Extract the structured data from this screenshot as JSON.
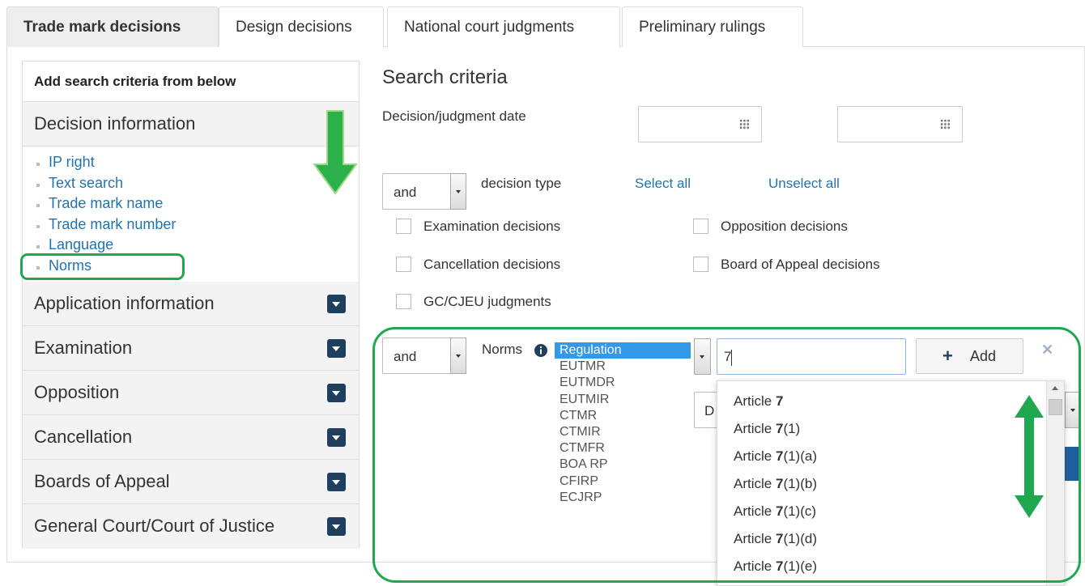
{
  "tabs": [
    "Trade mark decisions",
    "Design decisions",
    "National court judgments",
    "Preliminary rulings"
  ],
  "sidebar": {
    "header": "Add search criteria from below",
    "decision_info_title": "Decision information",
    "decision_info_items": [
      "IP right",
      "Text search",
      "Trade mark name",
      "Trade mark number",
      "Language",
      "Norms"
    ],
    "sections": [
      "Application information",
      "Examination",
      "Opposition",
      "Cancellation",
      "Boards of Appeal",
      "General Court/Court of Justice"
    ]
  },
  "criteria": {
    "title": "Search criteria",
    "date_label": "Decision/judgment date",
    "operator": "and",
    "decision_type_label": "decision type",
    "select_all": "Select all",
    "unselect_all": "Unselect all",
    "checkboxes": [
      "Examination decisions",
      "Opposition decisions",
      "Cancellation decisions",
      "Board of Appeal decisions",
      "GC/CJEU judgments"
    ],
    "norms_operator": "and",
    "norms_label": "Norms",
    "norms_options": [
      "Regulation",
      "EUTMR",
      "EUTMDR",
      "EUTMIR",
      "CTMR",
      "CTMIR",
      "CTMFR",
      "BOA RP",
      "CFIRP",
      "ECJRP"
    ],
    "norms_input_value": "7",
    "add_label": "Add",
    "hidden_select_partial": "D",
    "suggestions": [
      {
        "prefix": "Article ",
        "bold": "7",
        "suffix": ""
      },
      {
        "prefix": "Article ",
        "bold": "7",
        "suffix": "(1)"
      },
      {
        "prefix": "Article ",
        "bold": "7",
        "suffix": "(1)(a)"
      },
      {
        "prefix": "Article ",
        "bold": "7",
        "suffix": "(1)(b)"
      },
      {
        "prefix": "Article ",
        "bold": "7",
        "suffix": "(1)(c)"
      },
      {
        "prefix": "Article ",
        "bold": "7",
        "suffix": "(1)(d)"
      },
      {
        "prefix": "Article ",
        "bold": "7",
        "suffix": "(1)(e)"
      }
    ]
  },
  "colors": {
    "link": "#1f73b0",
    "highlight": "#1fa84f",
    "toggle": "#1f3f5f",
    "selected": "#3399e6"
  }
}
